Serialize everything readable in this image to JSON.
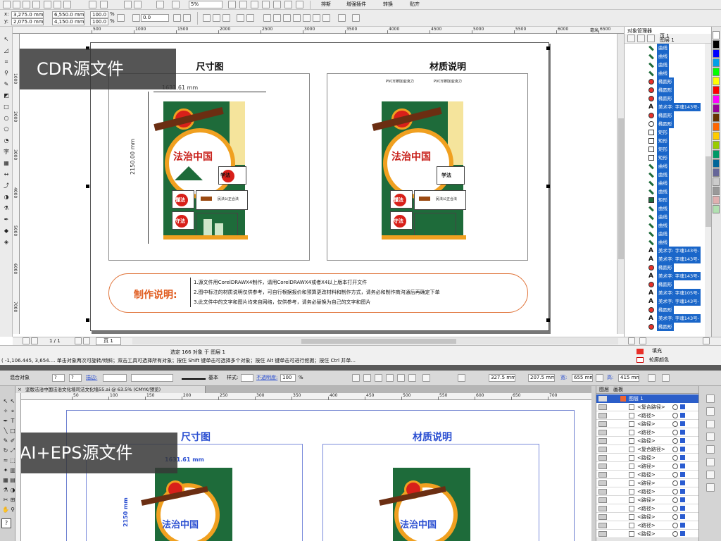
{
  "cdr": {
    "banner": "CDR源文件",
    "toolbar1": {
      "zoom": "5%",
      "snap": "排斯",
      "plugin": "增强插件",
      "convert": "转换",
      "paste": "贴齐"
    },
    "props": {
      "x": "3,275.0 mm",
      "y": "2,075.0 mm",
      "w": "6,550.0 mm",
      "h": "4,150.0 mm",
      "sx": "100.0",
      "sy": "100.0",
      "pct": "%",
      "angle": "0.0"
    },
    "ruler_h": [
      "500",
      "1000",
      "1500",
      "2000",
      "2500",
      "3000",
      "3500",
      "4000",
      "4500",
      "5000",
      "5500",
      "6000",
      "6500",
      "7000"
    ],
    "ruler_v": [
      "1000",
      "2000",
      "3000",
      "4000",
      "5000",
      "6000",
      "7000"
    ],
    "ruler_unit": "毫米",
    "left_title": "尺寸图",
    "right_title": "材质说明",
    "dim_w": "1631.61 mm",
    "dim_h": "2150.00 mm",
    "art": {
      "law_cn": "法治中国",
      "learn": "学法",
      "know": "懂法",
      "keep": "守法",
      "gavel_text": "民法公正合法",
      "pvc": "PVC印刷加亚克力"
    },
    "note_label": "制作说明:",
    "notes": [
      "1.源文件用CorelDRAWX4制作，请用CorelDRAWX4或者X4以上版本打开文件",
      "2.图中标注的材质说明仅供参考，可自行根据报价和预算更改材料和制作方式，请务必和制作商沟通后再确定下单",
      "3.此文件中的文字和图片均来自网络，仅供参考，请务必替换为自己的文字和图片"
    ],
    "page_nav": {
      "count": "1 / 1",
      "tab": "页 1"
    },
    "status_center": "选定 166 对象 于 图层 1",
    "status_bottom": "( -1,106.445, 3,654.... 单击对象两次可旋转/倾斜；双击工具可选择所有对象；按住 Shift 键单击可选择多个对象；按住 Alt 键单击可进行挖掘；按住 Ctrl 并单...",
    "fill_label": "填充",
    "outline_label": "轮廓颜色",
    "obj_panel": {
      "title": "对象管理器",
      "head_label": "图层 1",
      "head_prefix": "页 1",
      "rows": [
        {
          "icon": "curve",
          "label": "曲线",
          "sel": true
        },
        {
          "icon": "curve",
          "label": "曲线",
          "sel": true
        },
        {
          "icon": "curve",
          "label": "曲线",
          "sel": true
        },
        {
          "icon": "curve",
          "label": "曲线",
          "sel": true
        },
        {
          "icon": "ellipse",
          "label": "椭圆形",
          "sel": true
        },
        {
          "icon": "ellipse",
          "label": "椭圆形",
          "sel": true
        },
        {
          "icon": "ellipse",
          "label": "椭圆形",
          "sel": true
        },
        {
          "icon": "text",
          "label": "美术字: 字魂143号-",
          "sel": true
        },
        {
          "icon": "ellipse",
          "label": "椭圆形",
          "sel": true
        },
        {
          "icon": "ellipse-o",
          "label": "椭圆形",
          "sel": true
        },
        {
          "icon": "rect",
          "label": "矩形",
          "sel": true
        },
        {
          "icon": "rect",
          "label": "矩形",
          "sel": true
        },
        {
          "icon": "rect",
          "label": "矩形",
          "sel": true
        },
        {
          "icon": "rect",
          "label": "矩形",
          "sel": true
        },
        {
          "icon": "curve",
          "label": "曲线",
          "sel": true
        },
        {
          "icon": "curve",
          "label": "曲线",
          "sel": true
        },
        {
          "icon": "curve",
          "label": "曲线",
          "sel": true
        },
        {
          "icon": "curve",
          "label": "曲线",
          "sel": true
        },
        {
          "icon": "rect-g",
          "label": "矩形",
          "sel": true
        },
        {
          "icon": "curve",
          "label": "曲线",
          "sel": true
        },
        {
          "icon": "curve",
          "label": "曲线",
          "sel": true
        },
        {
          "icon": "curve",
          "label": "曲线",
          "sel": true
        },
        {
          "icon": "curve",
          "label": "曲线",
          "sel": true
        },
        {
          "icon": "curve",
          "label": "曲线",
          "sel": true
        },
        {
          "icon": "text",
          "label": "美术字: 字魂143号-",
          "sel": true
        },
        {
          "icon": "text",
          "label": "美术字: 字魂143号-",
          "sel": true
        },
        {
          "icon": "ellipse",
          "label": "椭圆形",
          "sel": true
        },
        {
          "icon": "text",
          "label": "美术字: 字魂143号-",
          "sel": true
        },
        {
          "icon": "ellipse",
          "label": "椭圆形",
          "sel": true
        },
        {
          "icon": "text",
          "label": "美术字: 字魂105号-",
          "sel": true
        },
        {
          "icon": "text",
          "label": "美术字: 字魂143号-",
          "sel": true
        },
        {
          "icon": "ellipse",
          "label": "椭圆形",
          "sel": true
        },
        {
          "icon": "text",
          "label": "美术字: 字魂143号-",
          "sel": true
        },
        {
          "icon": "ellipse",
          "label": "椭圆形",
          "sel": true
        }
      ]
    }
  },
  "ai": {
    "banner": "AI+EPS源文件",
    "control": {
      "label": "混合对象",
      "stroke": "描边:",
      "line_style": "基本",
      "style": "样式:",
      "opacity_label": "不透明度:",
      "opacity": "100",
      "pct": "%",
      "x": "327.5 mm",
      "y": "207.5 mm",
      "w": "655 mm",
      "h": "415 mm",
      "w_label": "宽:",
      "h_label": "高:"
    },
    "doc_tab": "坚版法治中国法治文化墙司法文化墙55.ai @ 63.5% (CMYK/预览)",
    "ruler": [
      "50",
      "100",
      "150",
      "200",
      "250",
      "300",
      "350",
      "400",
      "450",
      "500",
      "550",
      "600",
      "650",
      "700"
    ],
    "left_title": "尺寸图",
    "right_title": "材质说明",
    "dim_w": "1631.61 mm",
    "dim_h": "2150 mm",
    "law_cn": "法治中国",
    "layers_tabs": [
      "图层",
      "画板"
    ],
    "layer_head": "图层 1",
    "layer_rows": [
      "<复合路径>",
      "<路径>",
      "<路径>",
      "<路径>",
      "<路径>",
      "<复合路径>",
      "<路径>",
      "<路径>",
      "<路径>",
      "<路径>",
      "<路径>",
      "<路径>",
      "<路径>",
      "<路径>",
      "<路径>",
      "<路径>"
    ]
  },
  "colors": {
    "cdr_select": "#1a66c9",
    "ai_accent": "#2b4fd1",
    "brand_green": "#1e6b3a",
    "brand_red": "#c8201a",
    "brand_orange": "#f0a020"
  },
  "palette": [
    "#ffffff",
    "#000000",
    "#0000ff",
    "#00a0e9",
    "#00ff00",
    "#ffff00",
    "#ff0000",
    "#ff00ff",
    "#990099",
    "#663300",
    "#ff6600",
    "#ffcc00",
    "#99cc00",
    "#009966",
    "#006699",
    "#666699",
    "#cccccc",
    "#999999",
    "#e0b0b0",
    "#b0e0b0"
  ]
}
